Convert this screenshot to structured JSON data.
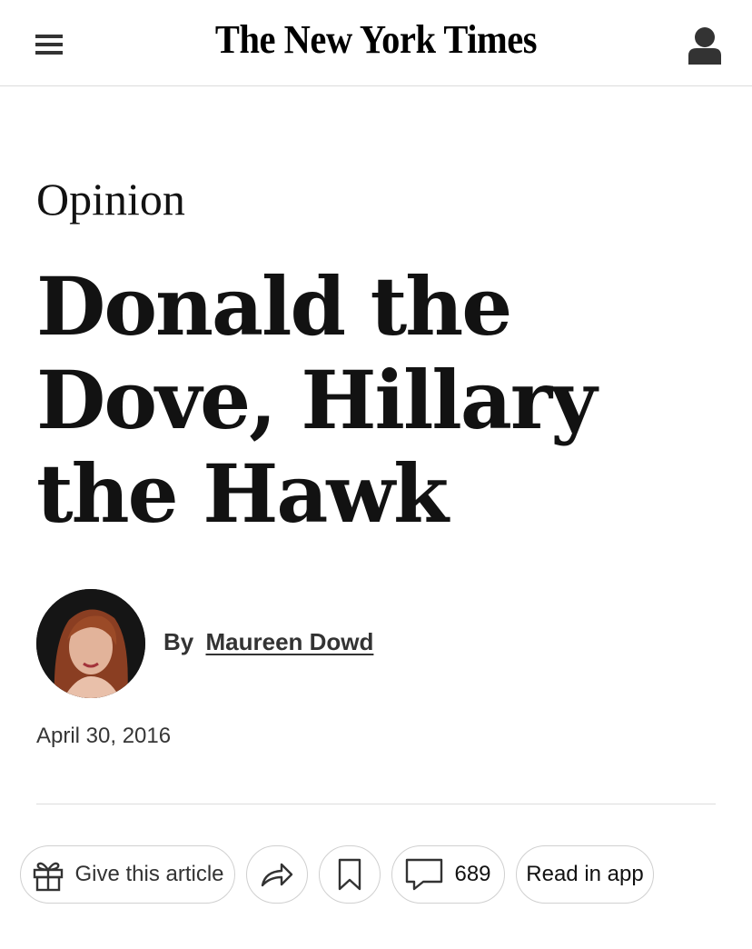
{
  "header": {
    "masthead": "The New York Times",
    "menu_icon": "hamburger-menu-icon",
    "account_icon": "account-icon"
  },
  "article": {
    "kicker": "Opinion",
    "headline": "Donald the Dove, Hillary the Hawk",
    "byline_prefix": "By",
    "author": "Maureen Dowd",
    "date": "April 30, 2016"
  },
  "actions": {
    "gift_label": "Give this article",
    "gift_icon": "gift-icon",
    "share_icon": "share-arrow-icon",
    "save_icon": "bookmark-icon",
    "comments_icon": "comment-bubble-icon",
    "comments_count": "689",
    "read_in_app_label": "Read in app"
  }
}
